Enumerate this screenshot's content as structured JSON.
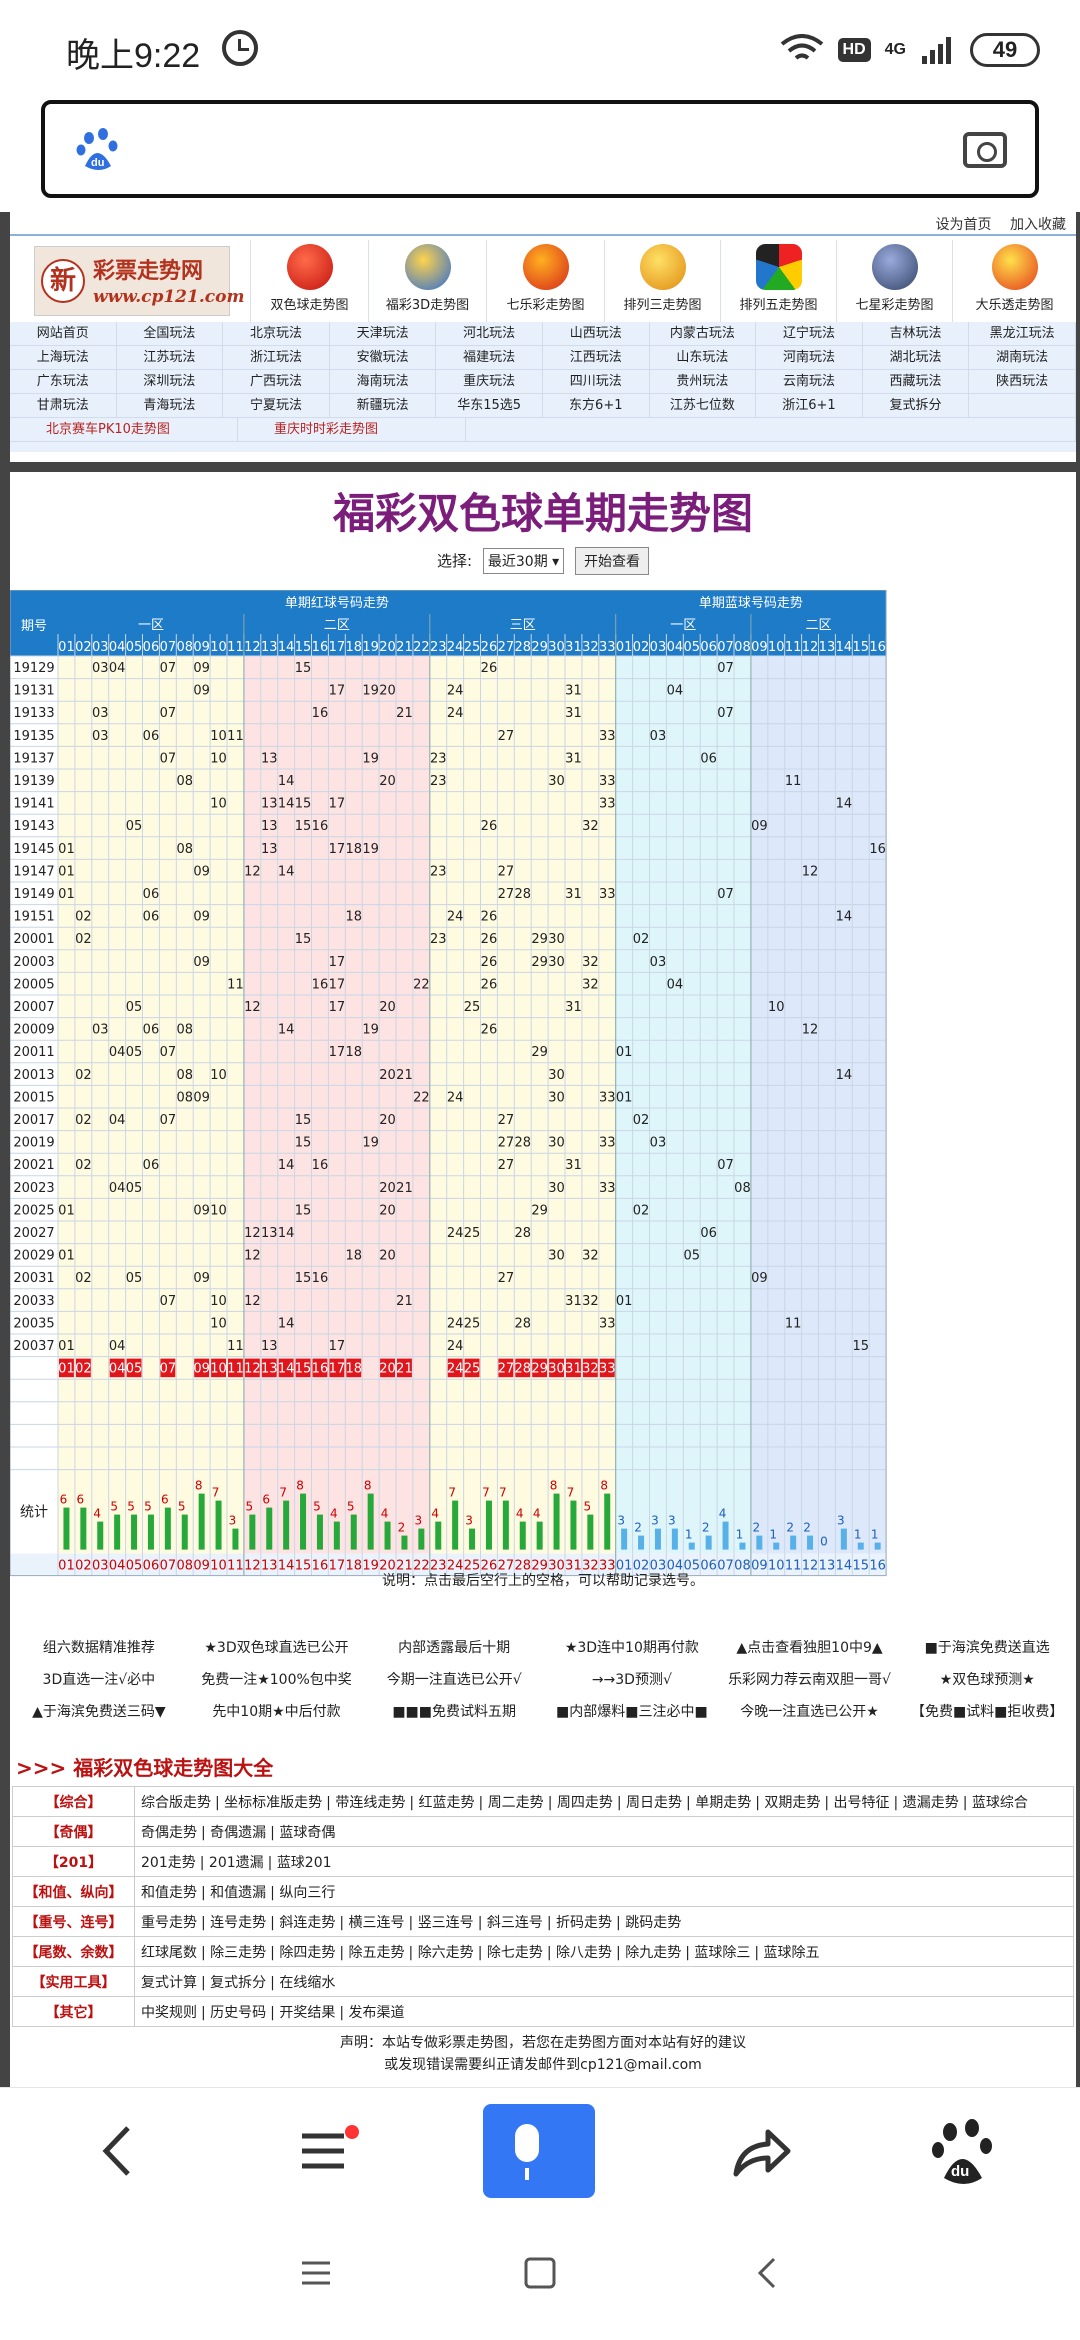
{
  "status_bar": {
    "time": "晚上9:22",
    "network": "4G",
    "hd": "HD",
    "battery": "49"
  },
  "browser": {
    "search_placeholder": ""
  },
  "site": {
    "top_links": [
      "设为首页",
      "加入收藏"
    ],
    "logo": {
      "name": "彩票走势网",
      "url": "www.cp121.com",
      "badge": "新"
    },
    "lottery_links": [
      "双色球走势图",
      "福彩3D走势图",
      "七乐彩走势图",
      "排列三走势图",
      "排列五走势图",
      "七星彩走势图",
      "大乐透走势图"
    ],
    "nav_rows": [
      [
        "网站首页",
        "全国玩法",
        "北京玩法",
        "天津玩法",
        "河北玩法",
        "山西玩法",
        "内蒙古玩法",
        "辽宁玩法",
        "吉林玩法",
        "黑龙江玩法"
      ],
      [
        "上海玩法",
        "江苏玩法",
        "浙江玩法",
        "安徽玩法",
        "福建玩法",
        "江西玩法",
        "山东玩法",
        "河南玩法",
        "湖北玩法",
        "湖南玩法"
      ],
      [
        "广东玩法",
        "深圳玩法",
        "广西玩法",
        "海南玩法",
        "重庆玩法",
        "四川玩法",
        "贵州玩法",
        "云南玩法",
        "西藏玩法",
        "陕西玩法"
      ],
      [
        "甘肃玩法",
        "青海玩法",
        "宁夏玩法",
        "新疆玩法",
        "华东15选5",
        "东方6+1",
        "江苏七位数",
        "浙江6+1",
        "复式拆分",
        ""
      ]
    ],
    "special_links": [
      "北京赛车PK10走势图",
      "重庆时时彩走势图"
    ]
  },
  "page": {
    "title": "福彩双色球单期走势图",
    "select_label": "选择:",
    "select_value": "最近30期",
    "view_button": "开始查看"
  },
  "chart_data": {
    "type": "table",
    "header_period": "期号",
    "header_red": "单期红球号码走势",
    "header_blue": "单期蓝球号码走势",
    "red_zones": [
      "一区",
      "二区",
      "三区"
    ],
    "blue_zones": [
      "一区",
      "二区"
    ],
    "red_numbers": [
      "01",
      "02",
      "03",
      "04",
      "05",
      "06",
      "07",
      "08",
      "09",
      "10",
      "11",
      "12",
      "13",
      "14",
      "15",
      "16",
      "17",
      "18",
      "19",
      "20",
      "21",
      "22",
      "23",
      "24",
      "25",
      "26",
      "27",
      "28",
      "29",
      "30",
      "31",
      "32",
      "33"
    ],
    "blue_numbers": [
      "01",
      "02",
      "03",
      "04",
      "05",
      "06",
      "07",
      "08",
      "09",
      "10",
      "11",
      "12",
      "13",
      "14",
      "15",
      "16"
    ],
    "rows": [
      {
        "period": "19129",
        "red": [
          3,
          4,
          7,
          9,
          15,
          26
        ],
        "blue": 7
      },
      {
        "period": "19131",
        "red": [
          9,
          17,
          19,
          20,
          24,
          31
        ],
        "blue": 4
      },
      {
        "period": "19133",
        "red": [
          3,
          7,
          16,
          21,
          24,
          31
        ],
        "blue": 7
      },
      {
        "period": "19135",
        "red": [
          3,
          6,
          10,
          11,
          27,
          33
        ],
        "blue": 3
      },
      {
        "period": "19137",
        "red": [
          7,
          10,
          13,
          19,
          23,
          31
        ],
        "blue": 6
      },
      {
        "period": "19139",
        "red": [
          8,
          14,
          20,
          23,
          30,
          33
        ],
        "blue": 11
      },
      {
        "period": "19141",
        "red": [
          10,
          13,
          14,
          15,
          17,
          33
        ],
        "blue": 14
      },
      {
        "period": "19143",
        "red": [
          5,
          13,
          15,
          16,
          26,
          32
        ],
        "blue": 9
      },
      {
        "period": "19145",
        "red": [
          1,
          8,
          13,
          17,
          18,
          19
        ],
        "blue": 16
      },
      {
        "period": "19147",
        "red": [
          1,
          9,
          12,
          14,
          23,
          27
        ],
        "blue": 12
      },
      {
        "period": "19149",
        "red": [
          1,
          6,
          27,
          28,
          31,
          33
        ],
        "blue": 7
      },
      {
        "period": "19151",
        "red": [
          2,
          6,
          9,
          18,
          24,
          26
        ],
        "blue": 14
      },
      {
        "period": "20001",
        "red": [
          2,
          15,
          23,
          26,
          29,
          30
        ],
        "blue": 2
      },
      {
        "period": "20003",
        "red": [
          9,
          17,
          26,
          29,
          30,
          32
        ],
        "blue": 3
      },
      {
        "period": "20005",
        "red": [
          11,
          16,
          17,
          22,
          26,
          32
        ],
        "blue": 4
      },
      {
        "period": "20007",
        "red": [
          5,
          12,
          17,
          20,
          25,
          31
        ],
        "blue": 10
      },
      {
        "period": "20009",
        "red": [
          3,
          6,
          8,
          14,
          19,
          26
        ],
        "blue": 12
      },
      {
        "period": "20011",
        "red": [
          4,
          5,
          7,
          17,
          18,
          29
        ],
        "blue": 1
      },
      {
        "period": "20013",
        "red": [
          2,
          8,
          10,
          20,
          21,
          30
        ],
        "blue": 14
      },
      {
        "period": "20015",
        "red": [
          8,
          9,
          22,
          24,
          30,
          33
        ],
        "blue": 1
      },
      {
        "period": "20017",
        "red": [
          2,
          4,
          7,
          15,
          20,
          27
        ],
        "blue": 2
      },
      {
        "period": "20019",
        "red": [
          15,
          19,
          27,
          28,
          30,
          33
        ],
        "blue": 3
      },
      {
        "period": "20021",
        "red": [
          2,
          6,
          14,
          16,
          27,
          31
        ],
        "blue": 7
      },
      {
        "period": "20023",
        "red": [
          4,
          5,
          20,
          21,
          30,
          33
        ],
        "blue": 8
      },
      {
        "period": "20025",
        "red": [
          1,
          9,
          10,
          15,
          20,
          29
        ],
        "blue": 2
      },
      {
        "period": "20027",
        "red": [
          12,
          13,
          14,
          24,
          25,
          28
        ],
        "blue": 6
      },
      {
        "period": "20029",
        "red": [
          1,
          12,
          18,
          20,
          30,
          32
        ],
        "blue": 5
      },
      {
        "period": "20031",
        "red": [
          2,
          5,
          9,
          15,
          16,
          27
        ],
        "blue": 9
      },
      {
        "period": "20033",
        "red": [
          7,
          10,
          12,
          21,
          31,
          32
        ],
        "blue": 1
      },
      {
        "period": "20035",
        "red": [
          10,
          14,
          24,
          25,
          28,
          33
        ],
        "blue": 11
      },
      {
        "period": "20037",
        "red": [
          1,
          4,
          11,
          13,
          17,
          24
        ],
        "blue": 15
      }
    ],
    "highlight_red": [
      1,
      2,
      4,
      5,
      7,
      9,
      10,
      11,
      12,
      13,
      14,
      15,
      16,
      17,
      18,
      20,
      21,
      24,
      25,
      27,
      28,
      29,
      30,
      31,
      32,
      33
    ],
    "stat_label": "统计",
    "red_counts": [
      6,
      6,
      4,
      5,
      5,
      5,
      6,
      5,
      8,
      7,
      3,
      5,
      6,
      7,
      8,
      5,
      4,
      5,
      8,
      4,
      2,
      3,
      4,
      7,
      3,
      7,
      7,
      4,
      4,
      8,
      7,
      5,
      8
    ],
    "blue_counts": [
      3,
      2,
      3,
      3,
      1,
      2,
      4,
      1,
      2,
      1,
      2,
      2,
      0,
      3,
      1,
      1
    ]
  },
  "chart_note": "说明：点击最后空行上的空格，可以帮助记录选号。",
  "promo_rows": [
    [
      "组六数据精准推荐",
      "★3D双色球直选已公开",
      "内部透露最后十期",
      "★3D连中10期再付款",
      "▲点击查看独胆10中9▲",
      "■于海滨免费送直选"
    ],
    [
      "3D直选一注√必中",
      "免费一注★100%包中奖",
      "今期一注直选已公开√",
      "→→3D预测√",
      "乐彩网力荐云南双胆一哥√",
      "★双色球预测★"
    ],
    [
      "▲于海滨免费送三码▼",
      "先中10期★中后付款",
      "■■■免费试料五期",
      "■内部爆料■三注必中■",
      "今晚一注直选已公开★",
      "【免费■试料■拒收费】"
    ]
  ],
  "links_title": ">>> 福彩双色球走势图大全",
  "link_table": [
    {
      "cat": "【综合】",
      "links": [
        "综合版走势",
        "坐标标准版走势",
        "带连线走势",
        "红蓝走势",
        "周二走势",
        "周四走势",
        "周日走势",
        "单期走势",
        "双期走势",
        "出号特征",
        "遗漏走势",
        "蓝球综合"
      ]
    },
    {
      "cat": "【奇偶】",
      "links": [
        "奇偶走势",
        "奇偶遗漏",
        "蓝球奇偶"
      ]
    },
    {
      "cat": "【201】",
      "links": [
        "201走势",
        "201遗漏",
        "蓝球201"
      ]
    },
    {
      "cat": "【和值、纵向】",
      "links": [
        "和值走势",
        "和值遗漏",
        "纵向三行"
      ]
    },
    {
      "cat": "【重号、连号】",
      "links": [
        "重号走势",
        "连号走势",
        "斜连走势",
        "横三连号",
        "竖三连号",
        "斜三连号",
        "折码走势",
        "跳码走势"
      ]
    },
    {
      "cat": "【尾数、余数】",
      "links": [
        "红球尾数",
        "除三走势",
        "除四走势",
        "除五走势",
        "除六走势",
        "除七走势",
        "除八走势",
        "除九走势",
        "蓝球除三",
        "蓝球除五"
      ]
    },
    {
      "cat": "【实用工具】",
      "links": [
        "复式计算",
        "复式拆分",
        "在线缩水"
      ]
    },
    {
      "cat": "【其它】",
      "links": [
        "中奖规则",
        "历史号码",
        "开奖结果",
        "发布渠道"
      ]
    }
  ],
  "footer": [
    "声明：本站专做彩票走势图，若您在走势图方面对本站有好的建议",
    "或发现错误需要纠正请发邮件到cp121@mail.com"
  ],
  "colors": {
    "header_blue": "#1e7bc7",
    "red_ball": "#e0161c",
    "blue_text": "#1c5fbf",
    "bar_green": "#26a83a",
    "bar_blue": "#58b0e8",
    "zone_yellow": "#fffbe0",
    "zone_pink": "#fde3e1",
    "zone_cyan": "#def6fa",
    "zone_lightblue": "#dde9fa"
  }
}
